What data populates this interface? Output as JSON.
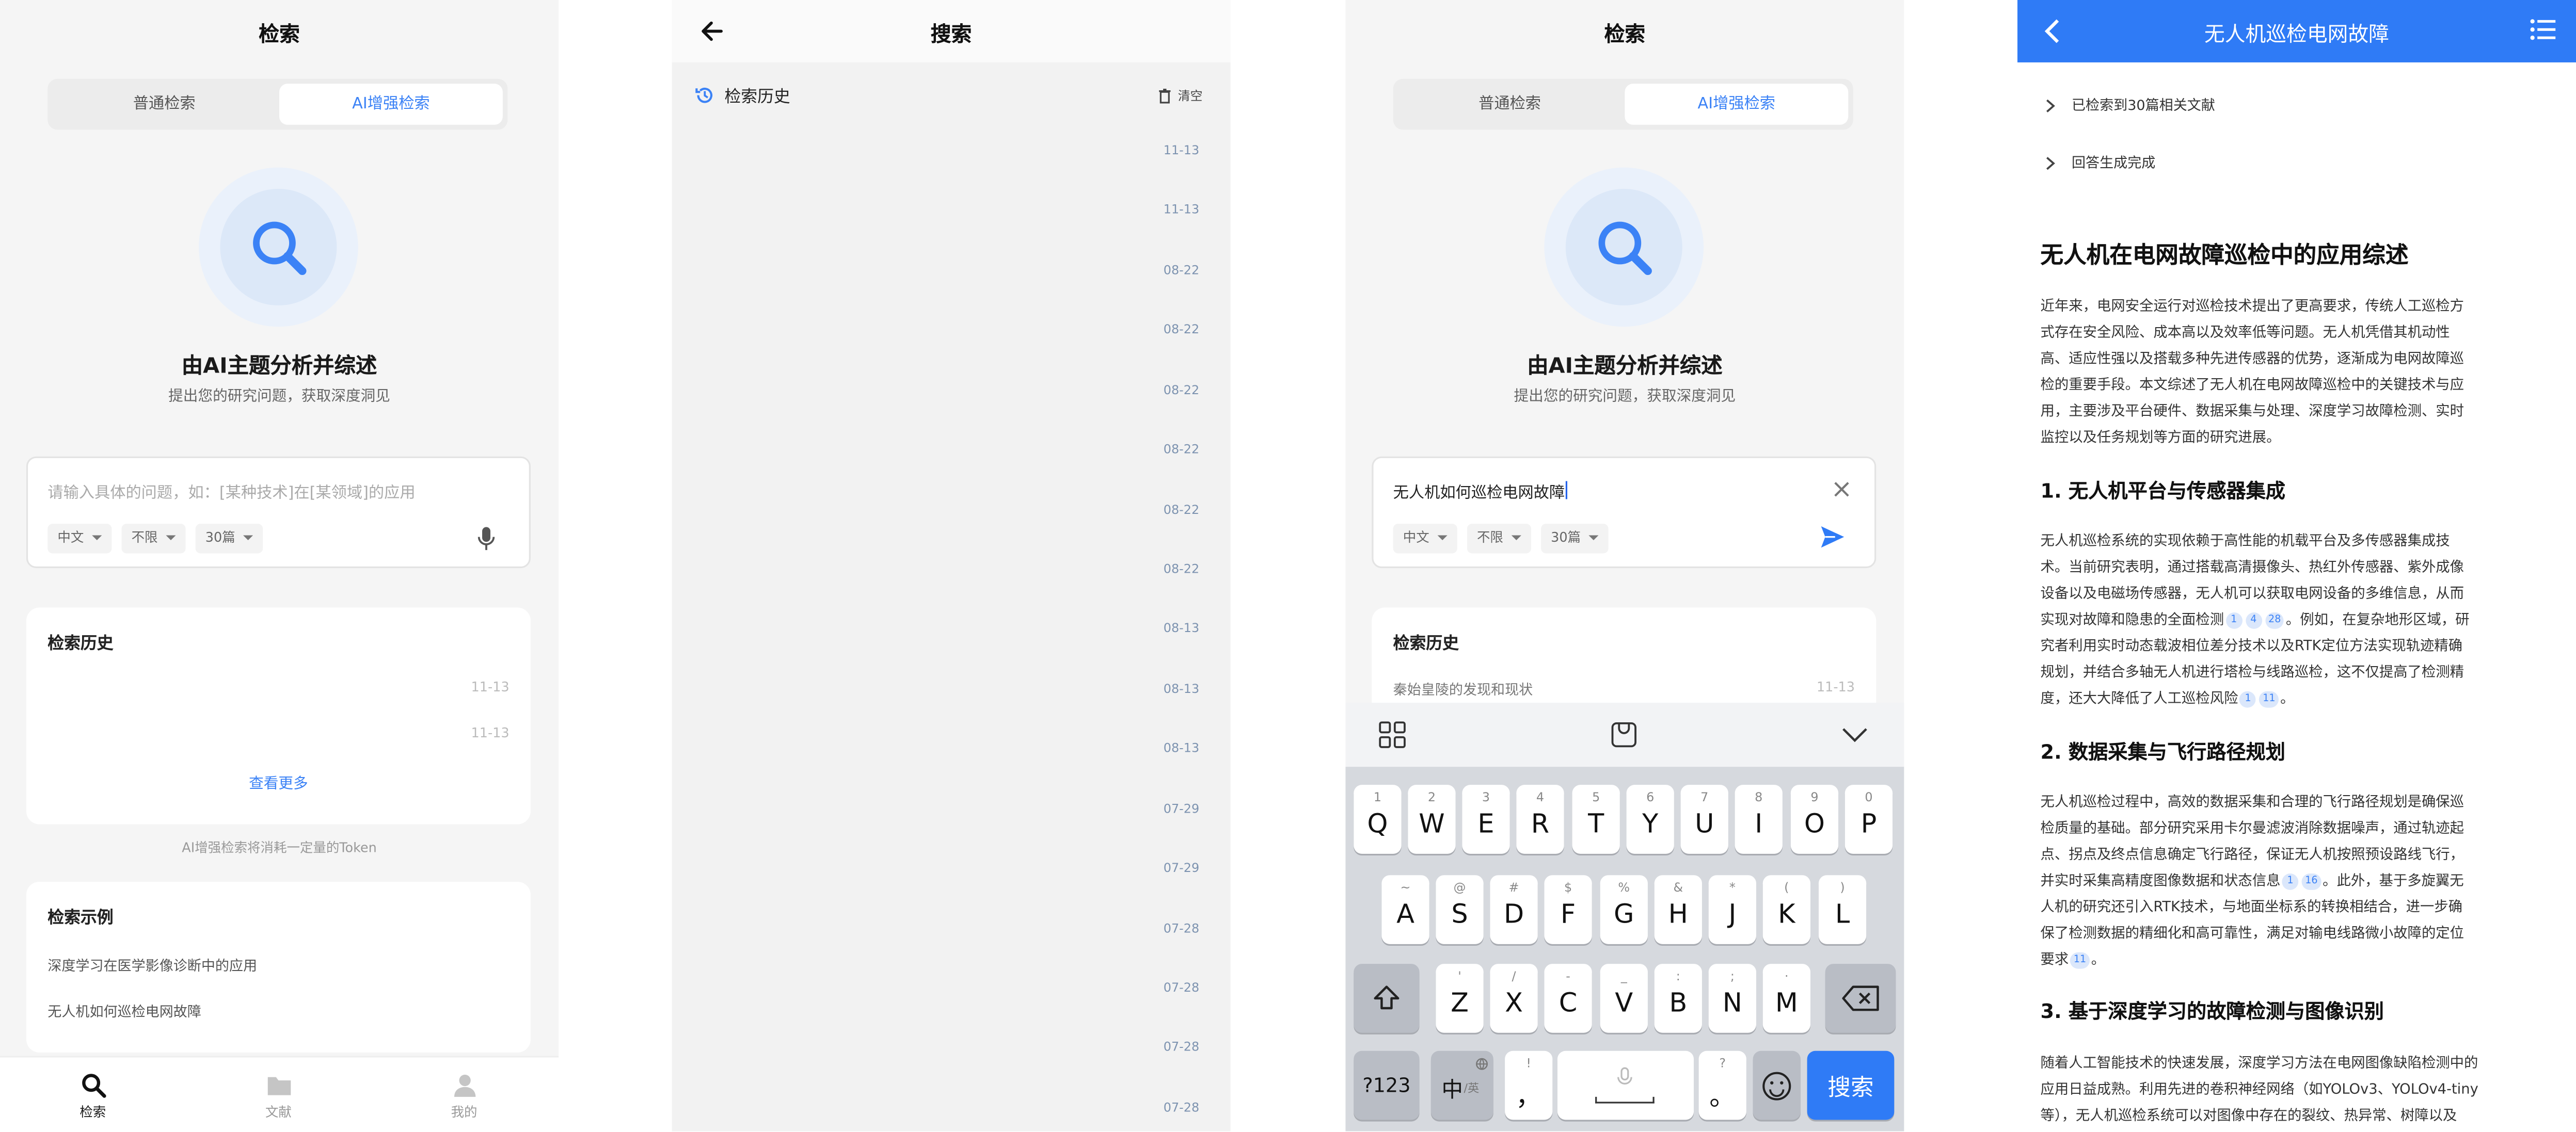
{
  "screen1": {
    "title": "检索",
    "tabs": [
      "普通检索",
      "AI增强检索"
    ],
    "hero_title": "由AI主题分析并综述",
    "hero_subtitle": "提出您的研究问题，获取深度洞见",
    "search_placeholder": "请输入具体的问题，如：[某种技术]在[某领域]的应用",
    "chips": [
      "中文",
      "不限",
      "30篇"
    ],
    "history_title": "检索历史",
    "history_dates": [
      "11-13",
      "11-13"
    ],
    "view_more": "查看更多",
    "token_note": "AI增强检索将消耗一定量的Token",
    "examples_title": "检索示例",
    "examples": [
      "深度学习在医学影像诊断中的应用",
      "无人机如何巡检电网故障"
    ],
    "tabbar": [
      "检索",
      "文献",
      "我的"
    ]
  },
  "screen2": {
    "title": "搜索",
    "history_label": "检索历史",
    "clear_label": "清空",
    "dates": [
      "11-13",
      "11-13",
      "08-22",
      "08-22",
      "08-22",
      "08-22",
      "08-22",
      "08-22",
      "08-13",
      "08-13",
      "08-13",
      "07-29",
      "07-29",
      "07-28",
      "07-28",
      "07-28",
      "07-28"
    ]
  },
  "screen3": {
    "title": "检索",
    "tabs": [
      "普通检索",
      "AI增强检索"
    ],
    "hero_title": "由AI主题分析并综述",
    "hero_subtitle": "提出您的研究问题，获取深度洞见",
    "search_value": "无人机如何巡检电网故障",
    "chips": [
      "中文",
      "不限",
      "30篇"
    ],
    "history_title": "检索历史",
    "history_item": "秦始皇陵的发现和现状",
    "history_date": "11-13",
    "keyboard": {
      "row1": [
        {
          "sup": "1",
          "key": "Q"
        },
        {
          "sup": "2",
          "key": "W"
        },
        {
          "sup": "3",
          "key": "E"
        },
        {
          "sup": "4",
          "key": "R"
        },
        {
          "sup": "5",
          "key": "T"
        },
        {
          "sup": "6",
          "key": "Y"
        },
        {
          "sup": "7",
          "key": "U"
        },
        {
          "sup": "8",
          "key": "I"
        },
        {
          "sup": "9",
          "key": "O"
        },
        {
          "sup": "0",
          "key": "P"
        }
      ],
      "row2": [
        {
          "sup": "~",
          "key": "A"
        },
        {
          "sup": "@",
          "key": "S"
        },
        {
          "sup": "#",
          "key": "D"
        },
        {
          "sup": "$",
          "key": "F"
        },
        {
          "sup": "%",
          "key": "G"
        },
        {
          "sup": "&",
          "key": "H"
        },
        {
          "sup": "*",
          "key": "J"
        },
        {
          "sup": "(",
          "key": "K"
        },
        {
          "sup": ")",
          "key": "L"
        }
      ],
      "row3": [
        {
          "sup": "'",
          "key": "Z"
        },
        {
          "sup": "/",
          "key": "X"
        },
        {
          "sup": "-",
          "key": "C"
        },
        {
          "sup": "_",
          "key": "V"
        },
        {
          "sup": ":",
          "key": "B"
        },
        {
          "sup": ";",
          "key": "N"
        },
        {
          "sup": "·",
          "key": "M"
        }
      ],
      "num_key": "?123",
      "lang_key": "中",
      "lang_sub": "/英",
      "comma_sup": "!",
      "comma_key": "，",
      "period_sup": "?",
      "period_key": "。",
      "search_key": "搜索"
    }
  },
  "screen4": {
    "title": "无人机巡检电网故障",
    "status": [
      "已检索到30篇相关文献",
      "回答生成完成"
    ],
    "article_title": "无人机在电网故障巡检中的应用综述",
    "intro": [
      "近年来，电网安全运行对巡检技术提出了更高要求，传统人工巡检方",
      "式存在安全风险、成本高以及效率低等问题。无人机凭借其机动性",
      "高、适应性强以及搭载多种先进传感器的优势，逐渐成为电网故障巡",
      "检的重要手段。本文综述了无人机在电网故障巡检中的关键技术与应",
      "用，主要涉及平台硬件、数据采集与处理、深度学习故障检测、实时",
      "监控以及任务规划等方面的研究进展。"
    ],
    "sections": [
      {
        "heading": "1. 无人机平台与传感器集成",
        "lines": [
          "无人机巡检系统的实现依赖于高性能的机载平台及多传感器集成技",
          "术。当前研究表明，通过搭载高清摄像头、热红外传感器、紫外成像",
          "设备以及电磁场传感器，无人机可以获取电网设备的多维信息，从而",
          "实现对故障和隐患的全面检测",
          "究者利用实时动态载波相位差分技术以及RTK定位方法实现轨迹精确",
          "规划，并结合多轴无人机进行塔检与线路巡检，这不仅提高了检测精",
          "度，还大大降低了人工巡检风险"
        ],
        "cite_a": [
          "1",
          "4",
          "28"
        ],
        "line4_tail": "。例如，在复杂地形区域，研",
        "cite_b": [
          "1",
          "11"
        ],
        "line7_tail": "。"
      },
      {
        "heading": "2. 数据采集与飞行路径规划",
        "lines": [
          "无人机巡检过程中，高效的数据采集和合理的飞行路径规划是确保巡",
          "检质量的基础。部分研究采用卡尔曼滤波消除数据噪声，通过轨迹起",
          "点、拐点及终点信息确定飞行路径，保证无人机按照预设路线飞行，",
          "并实时采集高精度图像数据和状态信息",
          "人机的研究还引入RTK技术，与地面坐标系的转换相结合，进一步确",
          "保了检测数据的精细化和高可靠性，满足对输电线路微小故障的定位",
          "要求"
        ],
        "cite_a": [
          "1",
          "16"
        ],
        "line4_tail": "。此外，基于多旋翼无",
        "cite_b": [
          "11"
        ],
        "line7_tail": "。"
      },
      {
        "heading": "3. 基于深度学习的故障检测与图像识别",
        "lines": [
          "随着人工智能技术的快速发展，深度学习方法在电网图像缺陷检测中的",
          "应用日益成熟。利用先进的卷积神经网络（如YOLOv3、YOLOv4-tiny",
          "等），无人机巡检系统可以对图像中存在的裂纹、热异常、树障以及"
        ]
      }
    ]
  }
}
